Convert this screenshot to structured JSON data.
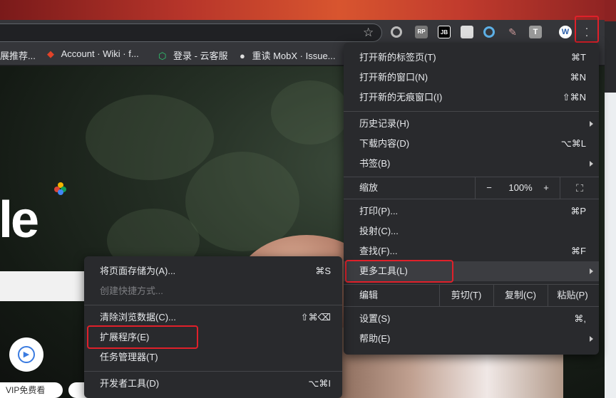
{
  "toolbar": {
    "extensions": [
      "circle-ext",
      "RP",
      "JB",
      "pdf-ext",
      "target-ext",
      "brush-ext",
      "T",
      "W"
    ],
    "menu_highlight_color": "#e0202a"
  },
  "bookmarks": [
    {
      "label": "展推荐..."
    },
    {
      "label": "Account · Wiki · f..."
    },
    {
      "label": "登录 - 云客服"
    },
    {
      "label": "重读 MobX · Issue..."
    }
  ],
  "page": {
    "logo_text": "le",
    "vip_label": "VIP免费看"
  },
  "main_menu": {
    "items": [
      {
        "label": "打开新的标签页(T)",
        "shortcut": "⌘T"
      },
      {
        "label": "打开新的窗口(N)",
        "shortcut": "⌘N"
      },
      {
        "label": "打开新的无痕窗口(I)",
        "shortcut": "⇧⌘N"
      },
      {
        "label": "历史记录(H)"
      },
      {
        "label": "下载内容(D)",
        "shortcut": "⌥⌘L"
      },
      {
        "label": "书签(B)"
      },
      {
        "label": "打印(P)...",
        "shortcut": "⌘P"
      },
      {
        "label": "投射(C)..."
      },
      {
        "label": "查找(F)...",
        "shortcut": "⌘F"
      },
      {
        "label": "更多工具(L)"
      },
      {
        "label": "设置(S)",
        "shortcut": "⌘,"
      },
      {
        "label": "帮助(E)"
      }
    ],
    "zoom": {
      "label": "缩放",
      "minus": "−",
      "value": "100%",
      "plus": "+"
    },
    "edit": {
      "label": "编辑",
      "cut": "剪切(T)",
      "copy": "复制(C)",
      "paste": "粘贴(P)"
    }
  },
  "sub_menu": {
    "items": [
      {
        "label": "将页面存储为(A)...",
        "shortcut": "⌘S"
      },
      {
        "label": "创建快捷方式..."
      },
      {
        "label": "清除浏览数据(C)...",
        "shortcut": "⇧⌘⌫"
      },
      {
        "label": "扩展程序(E)"
      },
      {
        "label": "任务管理器(T)"
      },
      {
        "label": "开发者工具(D)",
        "shortcut": "⌥⌘I"
      }
    ]
  }
}
